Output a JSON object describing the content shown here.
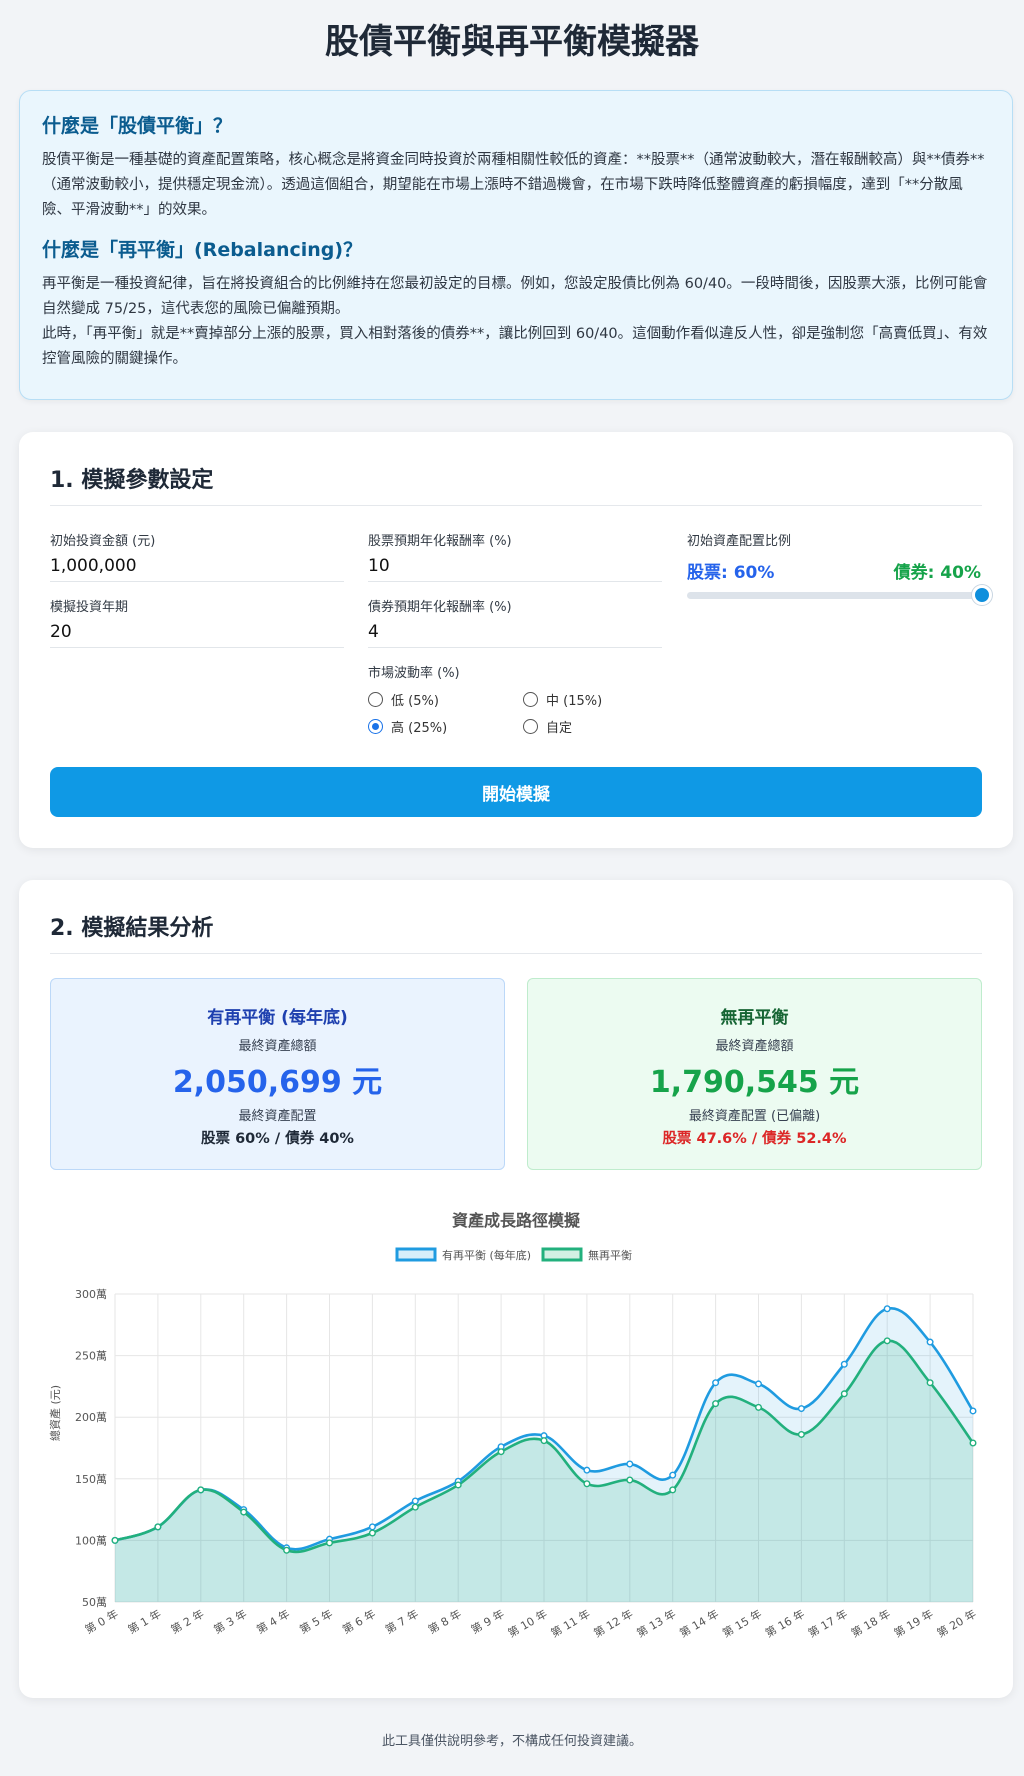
{
  "page": {
    "title": "股債平衡與再平衡模擬器",
    "footer": "此工具僅供說明參考，不構成任何投資建議。"
  },
  "intro": {
    "heading1": "什麼是「股債平衡」？",
    "para1": "股債平衡是一種基礎的資產配置策略，核心概念是將資金同時投資於兩種相關性較低的資產：**股票**（通常波動較大，潛在報酬較高）與**債券**（通常波動較小，提供穩定現金流）。透過這個組合，期望能在市場上漲時不錯過機會，在市場下跌時降低整體資產的虧損幅度，達到「**分散風險、平滑波動**」的效果。",
    "heading2": "什麼是「再平衡」(Rebalancing)？",
    "para2": "再平衡是一種投資紀律，旨在將投資組合的比例維持在您最初設定的目標。例如，您設定股債比例為 60/40。一段時間後，因股票大漲，比例可能會自然變成 75/25，這代表您的風險已偏離預期。",
    "para3": "此時，「再平衡」就是**賣掉部分上漲的股票，買入相對落後的債券**，讓比例回到 60/40。這個動作看似違反人性，卻是強制您「高賣低買」、有效控管風險的關鍵操作。"
  },
  "params": {
    "section_title": "1. 模擬參數設定",
    "initial_amount_label": "初始投資金額 (元)",
    "initial_amount_value": "1,000,000",
    "years_label": "模擬投資年期",
    "years_value": "20",
    "stock_return_label": "股票預期年化報酬率 (%)",
    "stock_return_value": "10",
    "bond_return_label": "債券預期年化報酬率 (%)",
    "bond_return_value": "4",
    "volatility_label": "市場波動率 (%)",
    "volatility_options": [
      "低 (5%)",
      "中 (15%)",
      "高 (25%)",
      "自定"
    ],
    "volatility_selected": "高 (25%)",
    "allocation_label": "初始資產配置比例",
    "allocation_stock": "股票: 60%",
    "allocation_bond": "債券: 40%",
    "allocation_stock_fraction": 0.6,
    "start_button": "開始模擬"
  },
  "results": {
    "section_title": "2. 模擬結果分析",
    "rebalanced": {
      "title": "有再平衡 (每年底)",
      "total_label": "最終資產總額",
      "total_value": "2,050,699 元",
      "alloc_label": "最終資產配置",
      "alloc_value": "股票 60% / 債券 40%"
    },
    "no_rebalance": {
      "title": "無再平衡",
      "total_label": "最終資產總額",
      "total_value": "1,790,545 元",
      "alloc_label": "最終資產配置 (已偏離)",
      "alloc_value": "股票 47.6% / 債券 52.4%"
    }
  },
  "colors": {
    "rebalanced": "#1f9be0",
    "no_rebalance": "#22b07d",
    "fill": "#cdecee"
  },
  "chart_data": {
    "type": "line",
    "title": "資產成長路徑模擬",
    "xlabel": "",
    "ylabel": "總資產 (元)",
    "categories": [
      "第 0 年",
      "第 1 年",
      "第 2 年",
      "第 3 年",
      "第 4 年",
      "第 5 年",
      "第 6 年",
      "第 7 年",
      "第 8 年",
      "第 9 年",
      "第 10 年",
      "第 11 年",
      "第 12 年",
      "第 13 年",
      "第 14 年",
      "第 15 年",
      "第 16 年",
      "第 17 年",
      "第 18 年",
      "第 19 年",
      "第 20 年"
    ],
    "y_ticks": [
      "50萬",
      "100萬",
      "150萬",
      "200萬",
      "250萬",
      "300萬"
    ],
    "ylim": [
      500000,
      3000000
    ],
    "grid": true,
    "legend_position": "top",
    "series": [
      {
        "name": "有再平衡 (每年底)",
        "values": [
          1000000,
          1110000,
          1410000,
          1250000,
          940000,
          1010000,
          1110000,
          1320000,
          1480000,
          1760000,
          1850000,
          1570000,
          1620000,
          1530000,
          2280000,
          2270000,
          2070000,
          2430000,
          2880000,
          2610000,
          2050699
        ]
      },
      {
        "name": "無再平衡",
        "values": [
          1000000,
          1110000,
          1410000,
          1230000,
          920000,
          980000,
          1060000,
          1270000,
          1450000,
          1720000,
          1810000,
          1460000,
          1490000,
          1410000,
          2110000,
          2080000,
          1860000,
          2190000,
          2620000,
          2280000,
          1790545
        ]
      }
    ]
  }
}
